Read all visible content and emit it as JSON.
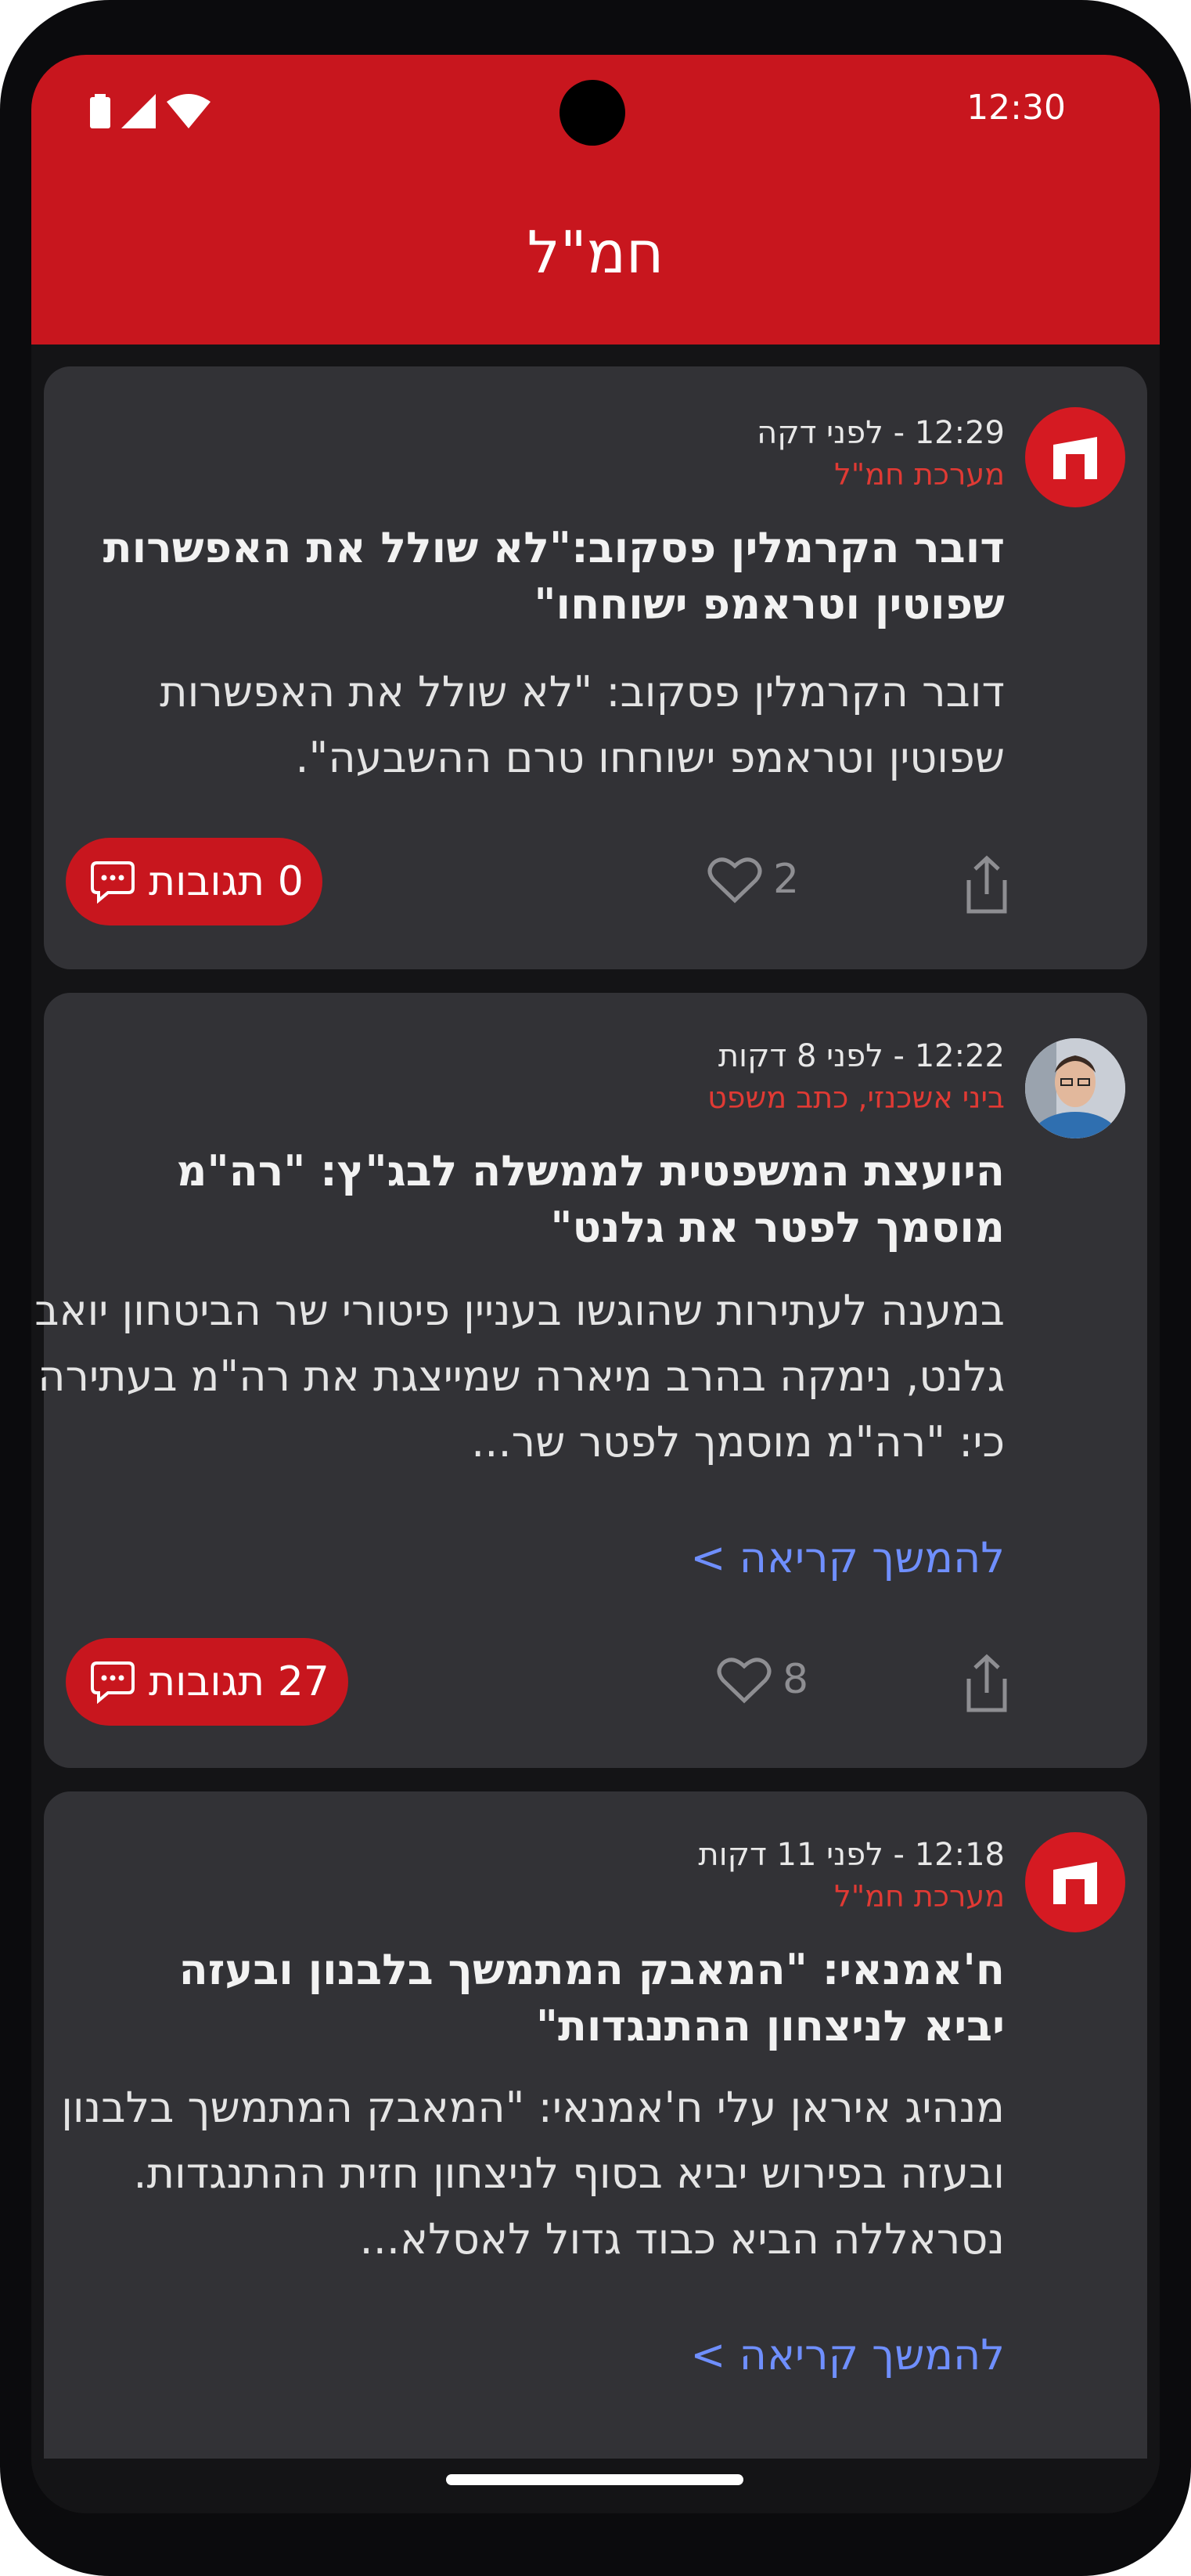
{
  "status_bar": {
    "time": "12:30"
  },
  "app": {
    "title": "חמ\"ל",
    "brand_color": "#c8161e"
  },
  "posts": [
    {
      "time": "12:29 - לפני דקה",
      "author": "מערכת חמ\"ל",
      "avatar": "brand-logo-icon",
      "headline": "דובר הקרמלין פסקוב:\"לא שולל את האפשרות שפוטין וטראמפ ישוחחו\"",
      "body": "דובר הקרמלין פסקוב: \"לא שולל את האפשרות שפוטין וטראמפ ישוחחו טרם ההשבעה\".",
      "likes": "2",
      "comments_label": "0 תגובות"
    },
    {
      "time": "12:22 - לפני 8 דקות",
      "author": "ביני אשכנזי, כתב משפט",
      "avatar": "author-photo",
      "headline": "היועצת המשפטית לממשלה לבג\"ץ: \"רה\"מ מוסמך לפטר את גלנט\"",
      "body": "במענה לעתירות שהוגשו בעניין פיטורי שר הביטחון יואב גלנט, נימקה בהרב מיארה שמייצגת את רה\"מ בעתירה כי: \"רה\"מ מוסמך לפטר שר...",
      "read_more": "להמשך קריאה >",
      "likes": "8",
      "comments_label": "27 תגובות"
    },
    {
      "time": "12:18 - לפני 11 דקות",
      "author": "מערכת חמ\"ל",
      "avatar": "brand-logo-icon",
      "headline": "ח'אמנאי: \"המאבק המתמשך בלבנון ובעזה יביא לניצחון ההתנגדות\"",
      "body": "מנהיג איראן עלי ח'אמנאי: \"המאבק המתמשך בלבנון ובעזה בפירוש יביא בסוף לניצחון חזית ההתנגדות. נסראללה הביא כבוד גדול לאסלא...",
      "read_more": "להמשך קריאה >"
    }
  ]
}
